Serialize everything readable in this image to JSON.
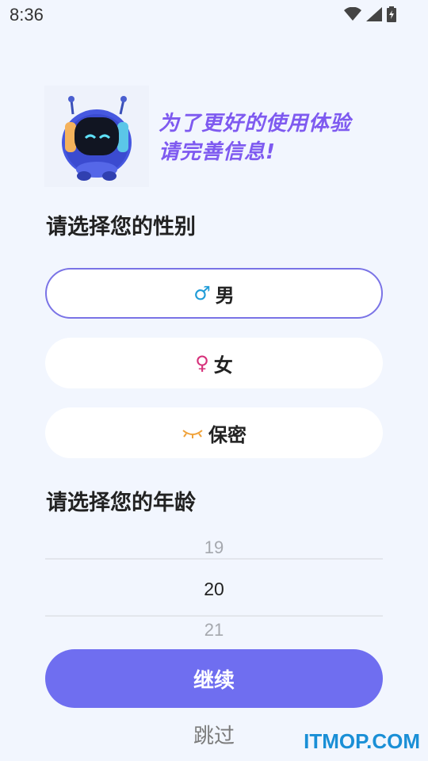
{
  "status_bar": {
    "time": "8:36",
    "icons": [
      "wifi-icon",
      "signal-icon",
      "battery-charging-icon"
    ]
  },
  "header": {
    "promo_line1": "为了更好的使用体验",
    "promo_line2": "请完善信息!"
  },
  "gender": {
    "title": "请选择您的性别",
    "options": [
      {
        "icon": "male-icon",
        "symbol": "♂",
        "label": "男",
        "selected": true,
        "color": "#1e9bd7"
      },
      {
        "icon": "female-icon",
        "symbol": "♀",
        "label": "女",
        "selected": false,
        "color": "#d6307a"
      },
      {
        "icon": "closed-eye-icon",
        "symbol": "",
        "label": "保密",
        "selected": false,
        "color": "#f0a23a"
      }
    ]
  },
  "age": {
    "title": "请选择您的年龄",
    "prev": "19",
    "current": "20",
    "next": "21"
  },
  "actions": {
    "continue_label": "继续",
    "skip_label": "跳过"
  },
  "watermark": "ITMOP.COM",
  "colors": {
    "accent": "#6f6ef0",
    "selected_border": "#7a73e6",
    "promo_text": "#7e5af0",
    "background": "#f2f6fe"
  }
}
